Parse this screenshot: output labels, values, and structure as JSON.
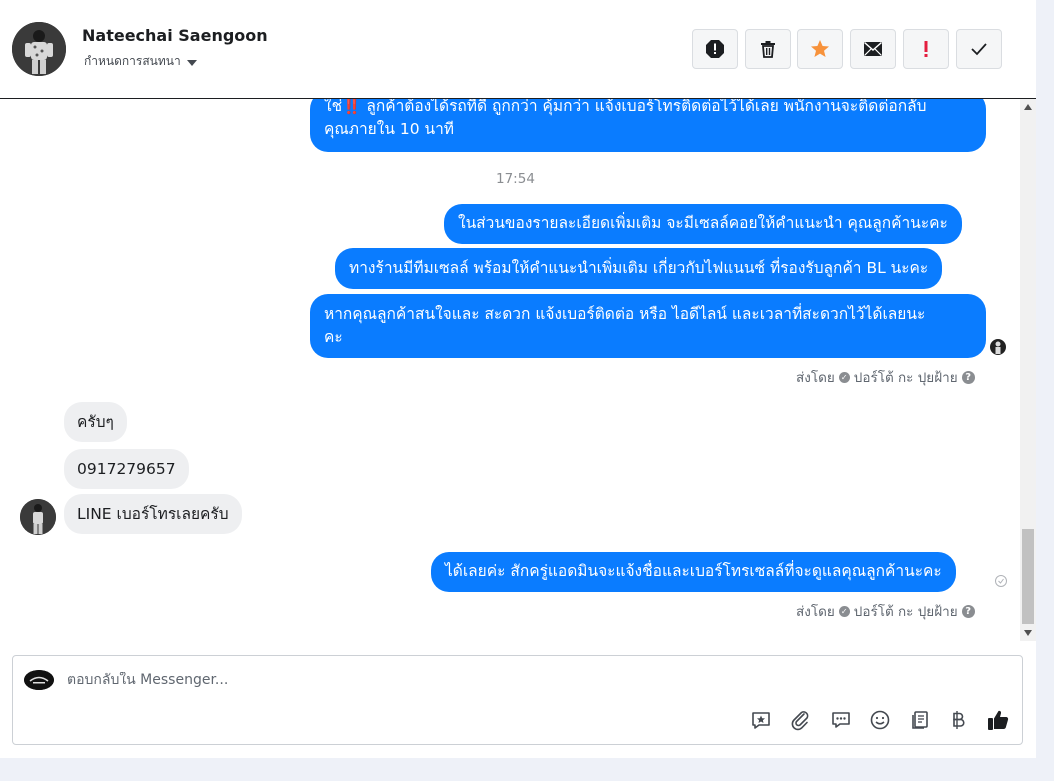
{
  "header": {
    "contact_name": "Nateechai Saengoon",
    "sub_label": "กำหนดการสนทนา",
    "actions": [
      {
        "name": "spam-button",
        "icon": "alert-octagon-icon"
      },
      {
        "name": "delete-button",
        "icon": "trash-icon"
      },
      {
        "name": "follow-up-button",
        "icon": "star-icon",
        "color": "#f7923b"
      },
      {
        "name": "unread-button",
        "icon": "envelope-icon"
      },
      {
        "name": "important-button",
        "icon": "exclamation-icon",
        "color": "#e41e3f"
      },
      {
        "name": "done-button",
        "icon": "check-icon"
      }
    ]
  },
  "messages": {
    "top_out_line1": "ใช่‼️ ลูกค้าต้องได้รถที่ดี ถูกกว่า คุ้มกว่า แจ้งเบอร์โทรติดต่อไว้ได้เลย พนักงานจะติดต่อกลับ",
    "top_out_line2": "คุณภายใน 10 นาที",
    "time_label": "17:54",
    "out_1": "ในส่วนของรายละเอียดเพิ่มเติม จะมีเซลล์คอยให้คำแนะนำ คุณลูกค้านะคะ",
    "out_2": "ทางร้านมีทีมเซลล์ พร้อมให้คำแนะนำเพิ่มเติม เกี่ยวกับไฟแนนซ์ ที่รองรับลูกค้า BL นะคะ",
    "out_3_line1": "หากคุณลูกค้าสนใจและ สะดวก แจ้งเบอร์ติดต่อ หรือ ไอดีไลน์ และเวลาที่สะดวกไว้ได้เลยนะ",
    "out_3_line2": "คะ",
    "sent_by_1": "ส่งโดย",
    "sender_1": "ปอร์โต้ กะ ปุยฝ้าย",
    "in_1": "ครับๆ",
    "in_2": "0917279657",
    "in_3": "LINE เบอร์โทรเลยครับ",
    "out_4": "ได้เลยค่ะ สักครู่แอดมินจะแจ้งชื่อและเบอร์โทรเซลล์ที่จะดูแลคุณลูกค้านะคะ",
    "sent_by_2": "ส่งโดย",
    "sender_2": "ปอร์โต้ กะ ปุยฝ้าย"
  },
  "composer": {
    "placeholder": "ตอบกลับใน Messenger...",
    "tools": [
      "saved-reply-icon",
      "attachment-icon",
      "chat-bubbles-icon",
      "emoji-icon",
      "notes-icon",
      "baht-icon",
      "thumbs-up-icon"
    ]
  },
  "colors": {
    "outgoing_bubble": "#0a7cff",
    "incoming_bubble": "#eeeff1",
    "star": "#f7923b",
    "important": "#e41e3f"
  }
}
